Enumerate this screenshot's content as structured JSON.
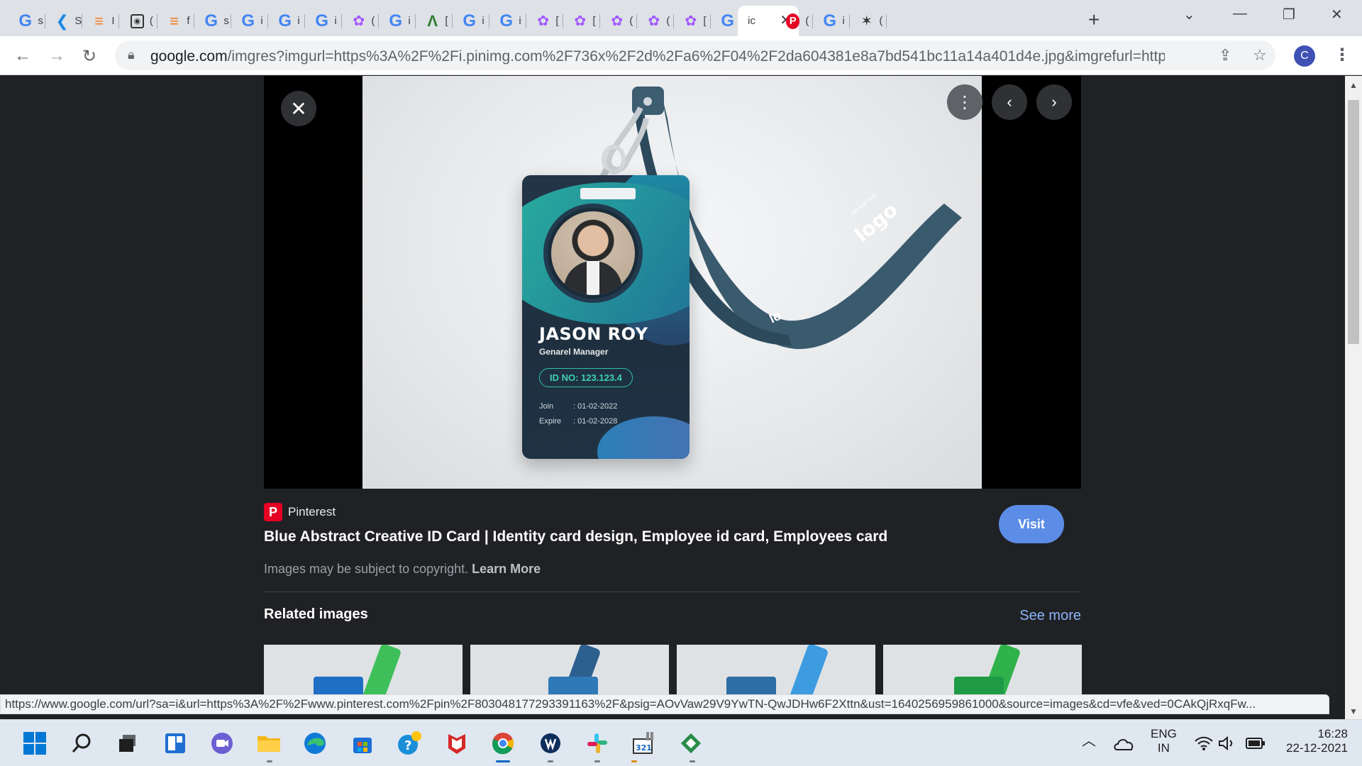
{
  "browser": {
    "tabs": [
      {
        "favicon": "google-icon",
        "title": "s"
      },
      {
        "favicon": "flutter-icon",
        "title": "S"
      },
      {
        "favicon": "stackoverflow-icon",
        "title": "I"
      },
      {
        "favicon": "box-icon",
        "title": "("
      },
      {
        "favicon": "stackoverflow-icon",
        "title": "f"
      },
      {
        "favicon": "google-icon",
        "title": "s"
      },
      {
        "favicon": "google-icon",
        "title": "i"
      },
      {
        "favicon": "google-icon",
        "title": "i"
      },
      {
        "favicon": "google-icon",
        "title": "i"
      },
      {
        "favicon": "figma-icon",
        "title": "("
      },
      {
        "favicon": "google-icon",
        "title": "i"
      },
      {
        "favicon": "android-icon",
        "title": "["
      },
      {
        "favicon": "google-icon",
        "title": "i"
      },
      {
        "favicon": "google-icon",
        "title": "i"
      },
      {
        "favicon": "figma-icon",
        "title": "["
      },
      {
        "favicon": "figma-icon",
        "title": "["
      },
      {
        "favicon": "figma-icon",
        "title": "("
      },
      {
        "favicon": "figma-icon",
        "title": "("
      },
      {
        "favicon": "figma-icon",
        "title": "["
      },
      {
        "favicon": "google-icon",
        "title": "i"
      },
      {
        "favicon": "none",
        "title": "ic",
        "active": true
      },
      {
        "favicon": "pinterest-icon",
        "title": "("
      },
      {
        "favicon": "google-icon",
        "title": "i"
      },
      {
        "favicon": "bee-icon",
        "title": "("
      }
    ],
    "url_host": "google.com",
    "url_path": "/imgres?imgurl=https%3A%2F%2Fi.pinimg.com%2F736x%2F2d%2Fa6%2F04%2F2da604381e8a7bd541bc11a14a401d4e.jpg&imgrefurl=https%3A...",
    "profile_initial": "C"
  },
  "viewer": {
    "card": {
      "name": "JASON ROY",
      "role": "Genarel Manager",
      "id_no": "ID NO: 123.123.4",
      "join_label": "Join",
      "join_value": ": 01-02-2022",
      "expire_label": "Expire",
      "expire_value": ": 01-02-2028",
      "strap_logo": "logo",
      "strap_small": "little logo here",
      "strap_logo_2": "lo"
    }
  },
  "info": {
    "source": "Pinterest",
    "title": "Blue Abstract Creative ID Card | Identity card design, Employee id card, Employees card",
    "visit_label": "Visit",
    "copyright_text": "Images may be subject to copyright.",
    "learn_more": "Learn More",
    "related_heading": "Related images",
    "see_more": "See more"
  },
  "status_url": "https://www.google.com/url?sa=i&url=https%3A%2F%2Fwww.pinterest.com%2Fpin%2F803048177293391163%2F&psig=AOvVaw29V9YwTN-QwJDHw6F2Xttn&ust=1640256959861000&source=images&cd=vfe&ved=0CAkQjRxqFw...",
  "taskbar": {
    "lang_top": "ENG",
    "lang_bottom": "IN",
    "time": "16:28",
    "date": "22-12-2021"
  }
}
